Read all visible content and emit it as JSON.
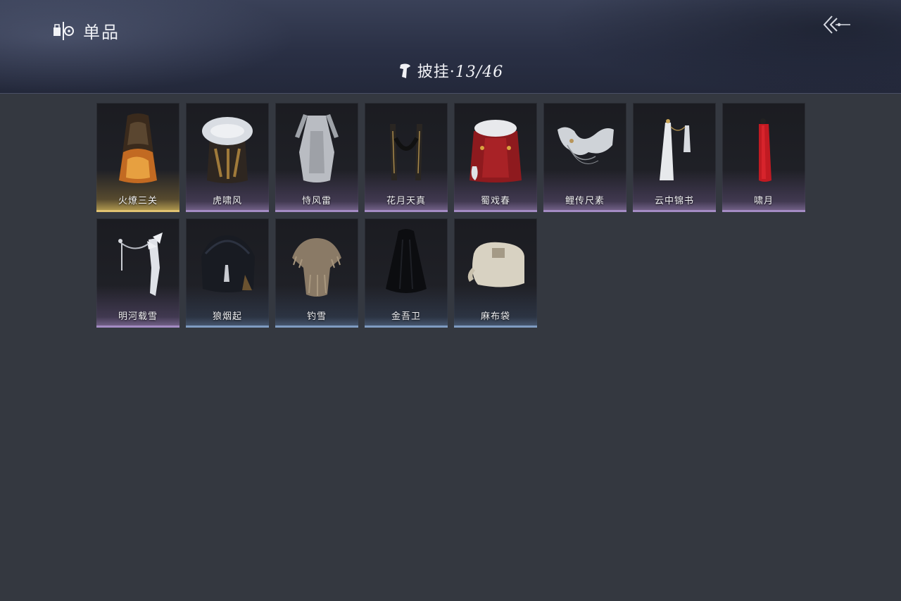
{
  "header": {
    "title": "单品",
    "category_label": "披挂",
    "category_separator": "·",
    "count": "13/46"
  },
  "items": [
    {
      "name": "火燎三关",
      "rarity": "gold"
    },
    {
      "name": "虎啸风",
      "rarity": "purple"
    },
    {
      "name": "恃风雷",
      "rarity": "purple"
    },
    {
      "name": "花月天真",
      "rarity": "purple"
    },
    {
      "name": "蜀戏春",
      "rarity": "purple"
    },
    {
      "name": "鲤传尺素",
      "rarity": "purple"
    },
    {
      "name": "云中锦书",
      "rarity": "purple"
    },
    {
      "name": "啸月",
      "rarity": "purple"
    },
    {
      "name": "明河载雪",
      "rarity": "purple"
    },
    {
      "name": "狼烟起",
      "rarity": "blue"
    },
    {
      "name": "钓雪",
      "rarity": "blue"
    },
    {
      "name": "金吾卫",
      "rarity": "blue"
    },
    {
      "name": "麻布袋",
      "rarity": "blue"
    }
  ],
  "colors": {
    "background": "#343840",
    "rarity_gold": "#e0c272",
    "rarity_purple": "#a48cc4",
    "rarity_blue": "#7f9cc2"
  },
  "icons": {
    "brand": "wardrobe-icon",
    "back": "back-arrow-icon",
    "category": "cape-icon"
  }
}
